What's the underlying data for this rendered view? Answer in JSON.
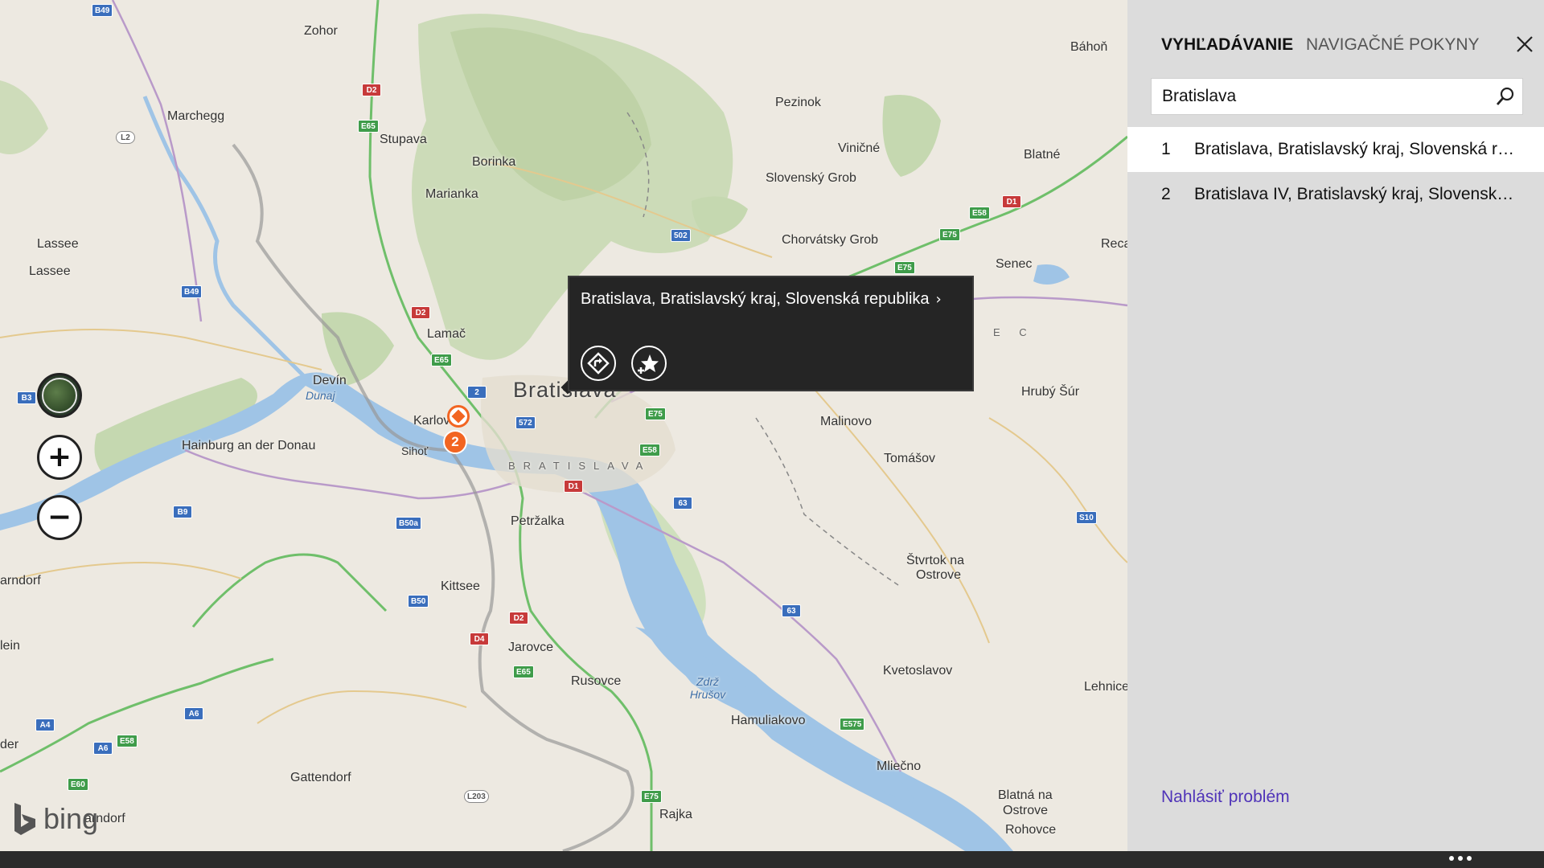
{
  "map": {
    "place_labels": [
      {
        "text": "Zohor",
        "cls": ""
      },
      {
        "text": "Marchegg",
        "cls": ""
      },
      {
        "text": "Stupava",
        "cls": ""
      },
      {
        "text": "Borinka",
        "cls": ""
      },
      {
        "text": "Marianka",
        "cls": ""
      },
      {
        "text": "Pezinok",
        "cls": ""
      },
      {
        "text": "Viničné",
        "cls": ""
      },
      {
        "text": "Slovenský Grob",
        "cls": ""
      },
      {
        "text": "Chorvátsky Grob",
        "cls": ""
      },
      {
        "text": "Báhoň",
        "cls": ""
      },
      {
        "text": "Blatné",
        "cls": ""
      },
      {
        "text": "Senec",
        "cls": ""
      },
      {
        "text": "Reca",
        "cls": ""
      },
      {
        "text": "Lassee",
        "cls": ""
      },
      {
        "text": "Lassee",
        "cls": ""
      },
      {
        "text": "Lamač",
        "cls": ""
      },
      {
        "text": "Devín",
        "cls": ""
      },
      {
        "text": "Dunaj",
        "cls": "water"
      },
      {
        "text": "Bratislava",
        "cls": "big"
      },
      {
        "text": "Karlov",
        "cls": ""
      },
      {
        "text": "Sihoť",
        "cls": ""
      },
      {
        "text": "Hainburg an der Donau",
        "cls": ""
      },
      {
        "text": "BRATISLAVA",
        "cls": "district"
      },
      {
        "text": "N E C",
        "cls": "district"
      },
      {
        "text": "Hrubý Šúr",
        "cls": ""
      },
      {
        "text": "Malinovo",
        "cls": ""
      },
      {
        "text": "Tomášov",
        "cls": ""
      },
      {
        "text": "Petržalka",
        "cls": ""
      },
      {
        "text": "Kittsee",
        "cls": ""
      },
      {
        "text": "arndorf",
        "cls": ""
      },
      {
        "text": "lein",
        "cls": ""
      },
      {
        "text": "Jarovce",
        "cls": ""
      },
      {
        "text": "Rusovce",
        "cls": ""
      },
      {
        "text": "Zdrž Hrušov",
        "cls": "water"
      },
      {
        "text": "Hamuliakovo",
        "cls": ""
      },
      {
        "text": "Štvrtok na",
        "cls": ""
      },
      {
        "text": "Ostrove",
        "cls": ""
      },
      {
        "text": "Kvetoslavov",
        "cls": ""
      },
      {
        "text": "Lehnice",
        "cls": ""
      },
      {
        "text": "Mliečno",
        "cls": ""
      },
      {
        "text": "Blatná na",
        "cls": ""
      },
      {
        "text": "Ostrove",
        "cls": ""
      },
      {
        "text": "Rohovce",
        "cls": ""
      },
      {
        "text": "der",
        "cls": ""
      },
      {
        "text": "Gattendorf",
        "cls": ""
      },
      {
        "text": "arndorf",
        "cls": ""
      },
      {
        "text": "Rajka",
        "cls": ""
      }
    ],
    "road_shields": [
      {
        "text": "B49",
        "color": "blue"
      },
      {
        "text": "L2",
        "color": "white"
      },
      {
        "text": "D2",
        "color": "red"
      },
      {
        "text": "E65",
        "color": "green"
      },
      {
        "text": "B49",
        "color": "blue"
      },
      {
        "text": "D2",
        "color": "red"
      },
      {
        "text": "E65",
        "color": "green"
      },
      {
        "text": "2",
        "color": "blue"
      },
      {
        "text": "572",
        "color": "blue"
      },
      {
        "text": "E75",
        "color": "green"
      },
      {
        "text": "E58",
        "color": "green"
      },
      {
        "text": "D1",
        "color": "red"
      },
      {
        "text": "63",
        "color": "blue"
      },
      {
        "text": "502",
        "color": "blue"
      },
      {
        "text": "E75",
        "color": "green"
      },
      {
        "text": "E75",
        "color": "green"
      },
      {
        "text": "E58",
        "color": "green"
      },
      {
        "text": "D1",
        "color": "red"
      },
      {
        "text": "B3",
        "color": "blue"
      },
      {
        "text": "B9",
        "color": "blue"
      },
      {
        "text": "B50a",
        "color": "blue"
      },
      {
        "text": "B50",
        "color": "blue"
      },
      {
        "text": "D2",
        "color": "red"
      },
      {
        "text": "D4",
        "color": "red"
      },
      {
        "text": "E65",
        "color": "green"
      },
      {
        "text": "63",
        "color": "blue"
      },
      {
        "text": "S10",
        "color": "blue"
      },
      {
        "text": "E575",
        "color": "green"
      },
      {
        "text": "A6",
        "color": "blue"
      },
      {
        "text": "E58",
        "color": "green"
      },
      {
        "text": "A4",
        "color": "blue"
      },
      {
        "text": "A6",
        "color": "blue"
      },
      {
        "text": "E60",
        "color": "green"
      },
      {
        "text": "L203",
        "color": "white"
      },
      {
        "text": "E75",
        "color": "green"
      }
    ],
    "pin_cluster_count": "2",
    "logo": "bing"
  },
  "map_controls": {
    "aerial_icon": "aerial-view-icon",
    "zoom_in_icon": "plus-icon",
    "zoom_out_icon": "minus-icon"
  },
  "popup": {
    "title": "Bratislava, Bratislavský kraj, Slovenská republika",
    "chevron": "›",
    "directions_icon": "directions-icon",
    "favorite_icon": "add-favorite-icon"
  },
  "panel": {
    "tabs": [
      {
        "label": "VYHĽADÁVANIE",
        "active": true
      },
      {
        "label": "NAVIGAČNÉ POKYNY",
        "active": false
      }
    ],
    "search": {
      "value": "Bratislava",
      "icon": "search-icon"
    },
    "results": [
      {
        "num": "1",
        "text": "Bratislava, Bratislavský kraj, Slovenská rep...",
        "active": true
      },
      {
        "num": "2",
        "text": "Bratislava IV, Bratislavský kraj, Slovenská r...",
        "active": false
      }
    ],
    "report_link": "Nahlásiť problém"
  },
  "colors": {
    "accent_orange": "#f26522",
    "link_purple": "#4f33b8",
    "panel_bg": "#dcdcdc",
    "popup_bg": "#252525"
  }
}
